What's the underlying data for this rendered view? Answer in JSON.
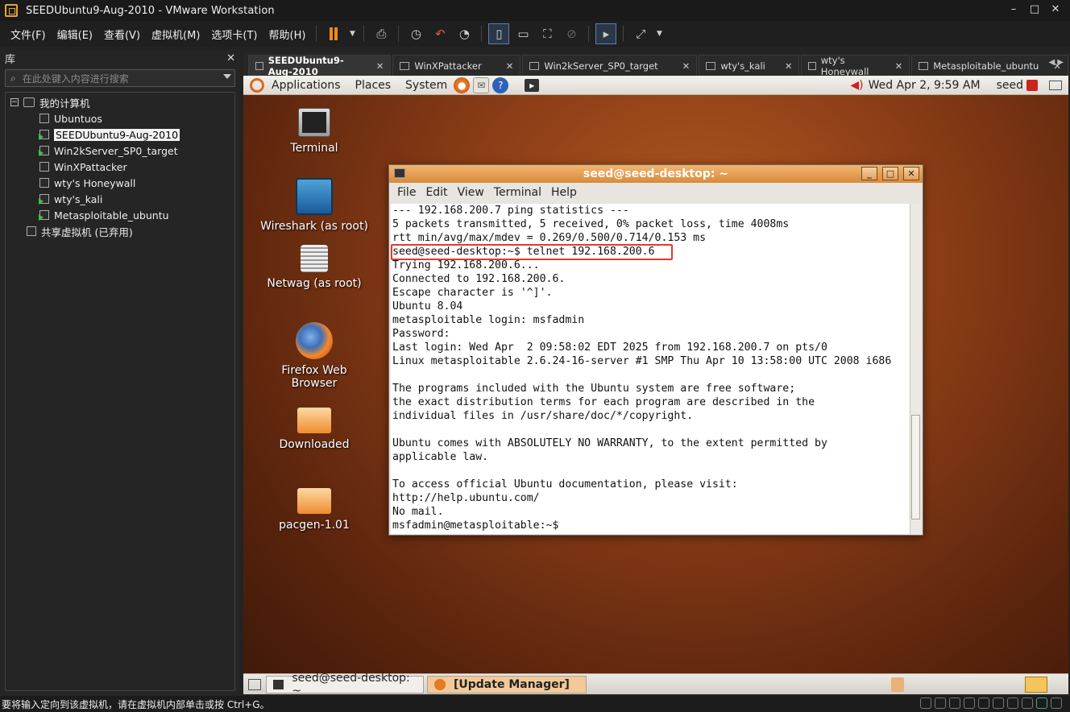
{
  "window": {
    "title": "SEEDUbuntu9-Aug-2010 - VMware Workstation",
    "minimize": "–",
    "maximize": "□",
    "close": "✕"
  },
  "menu": [
    "文件(F)",
    "编辑(E)",
    "查看(V)",
    "虚拟机(M)",
    "选项卡(T)",
    "帮助(H)"
  ],
  "library": {
    "title": "库",
    "close": "✕",
    "search_placeholder": "在此处键入内容进行搜索",
    "root": "我的计算机",
    "vms": [
      "Ubuntuos",
      "SEEDUbuntu9-Aug-2010",
      "Win2kServer_SP0_target",
      "WinXPattacker",
      "wty's Honeywall",
      "wty's_kali",
      "Metasploitable_ubuntu"
    ],
    "shared": "共享虚拟机 (已弃用)"
  },
  "tabs": [
    {
      "label": "SEEDUbuntu9-Aug-2010",
      "active": true
    },
    {
      "label": "WinXPattacker",
      "active": false
    },
    {
      "label": "Win2kServer_SP0_target",
      "active": false
    },
    {
      "label": "wty's_kali",
      "active": false
    },
    {
      "label": "wty's Honeywall",
      "active": false
    },
    {
      "label": "Metasploitable_ubuntu",
      "active": false
    }
  ],
  "guest": {
    "panel_menus": [
      "Applications",
      "Places",
      "System"
    ],
    "clock": "Wed Apr  2,  9:59 AM",
    "user": "seed",
    "desktop_icons": [
      "Terminal",
      "Wireshark (as root)",
      "Netwag (as root)",
      "Firefox Web Browser",
      "Downloaded",
      "pacgen-1.01"
    ],
    "terminal": {
      "title": "seed@seed-desktop: ~",
      "menus": [
        "File",
        "Edit",
        "View",
        "Terminal",
        "Help"
      ],
      "lines": [
        "--- 192.168.200.7 ping statistics ---",
        "5 packets transmitted, 5 received, 0% packet loss, time 4008ms",
        "rtt min/avg/max/mdev = 0.269/0.500/0.714/0.153 ms",
        "seed@seed-desktop:~$ telnet 192.168.200.6",
        "Trying 192.168.200.6...",
        "Connected to 192.168.200.6.",
        "Escape character is '^]'.",
        "Ubuntu 8.04",
        "metasploitable login: msfadmin",
        "Password:",
        "Last login: Wed Apr  2 09:58:02 EDT 2025 from 192.168.200.7 on pts/0",
        "Linux metasploitable 2.6.24-16-server #1 SMP Thu Apr 10 13:58:00 UTC 2008 i686",
        "",
        "The programs included with the Ubuntu system are free software;",
        "the exact distribution terms for each program are described in the",
        "individual files in /usr/share/doc/*/copyright.",
        "",
        "Ubuntu comes with ABSOLUTELY NO WARRANTY, to the extent permitted by",
        "applicable law.",
        "",
        "To access official Ubuntu documentation, please visit:",
        "http://help.ubuntu.com/",
        "No mail.",
        "msfadmin@metasploitable:~$"
      ]
    },
    "taskbar": [
      "seed@seed-desktop: ~",
      "[Update Manager]"
    ]
  },
  "statusbar": "要将输入定向到该虚拟机，请在虚拟机内部单击或按 Ctrl+G。",
  "colors": {
    "accent": "#f08a1c",
    "highlight_box": "#e23b2e",
    "terminal_title": "#d98a3c"
  }
}
